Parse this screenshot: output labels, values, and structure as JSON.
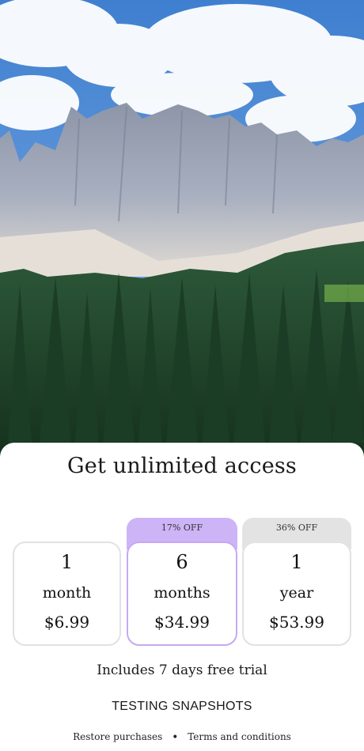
{
  "header": {
    "title": "Get unlimited access"
  },
  "plans": [
    {
      "number": "1",
      "unit": "month",
      "price": "$6.99",
      "badge": "",
      "badge_color": ""
    },
    {
      "number": "6",
      "unit": "months",
      "price": "$34.99",
      "badge": "17% OFF",
      "badge_color": "#cdb4f7"
    },
    {
      "number": "1",
      "unit": "year",
      "price": "$53.99",
      "badge": "36% OFF",
      "badge_color": "#e3e3e3"
    }
  ],
  "selected_plan_index": 1,
  "trial_text": "Includes 7 days free trial",
  "cta_label": "TESTING SNAPSHOTS",
  "footer": {
    "restore_label": "Restore purchases",
    "terms_label": "Terms and conditions"
  },
  "colors": {
    "accent": "#c7a8f3",
    "badge_selected": "#cdb4f7",
    "badge_other": "#e3e3e3",
    "sky": "#4f8fd8",
    "forest": "#1f4a2a"
  },
  "hero_image": "mountain-forest-photo"
}
